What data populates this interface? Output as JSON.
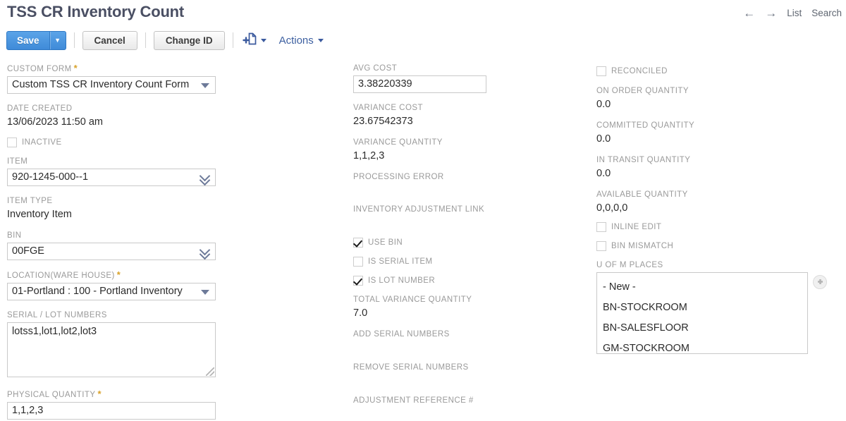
{
  "header": {
    "title": "TSS CR Inventory Count",
    "nav": {
      "back_icon": "arrow-left-icon",
      "forward_icon": "arrow-right-icon",
      "list_label": "List",
      "search_label": "Search"
    }
  },
  "toolbar": {
    "save_label": "Save",
    "save_dropdown_caret": "▼",
    "cancel_label": "Cancel",
    "change_id_label": "Change ID",
    "new_doc_icon": "new-document-plus-icon",
    "actions_label": "Actions"
  },
  "colors": {
    "primary_button": "#3f8bd8",
    "title_text": "#4a4f63",
    "label_text": "#9a9a9a",
    "value_text": "#2b2b2b",
    "required_marker": "#d8a22a",
    "link_text": "#3c5fa0"
  },
  "left_column": {
    "custom_form": {
      "label": "CUSTOM FORM",
      "required": "*",
      "value": "Custom TSS CR Inventory Count Form"
    },
    "date_created": {
      "label": "DATE CREATED",
      "value": "13/06/2023 11:50 am"
    },
    "inactive": {
      "label": "INACTIVE",
      "checked": false
    },
    "item": {
      "label": "ITEM",
      "value": "920-1245-000--1"
    },
    "item_type": {
      "label": "ITEM TYPE",
      "value": "Inventory Item"
    },
    "bin": {
      "label": "BIN",
      "value": "00FGE"
    },
    "location": {
      "label": "LOCATION(WARE HOUSE)",
      "required": "*",
      "value": "01-Portland : 100 - Portland Inventory"
    },
    "serial_lot_numbers": {
      "label": "SERIAL / LOT NUMBERS",
      "value": "lotss1,lot1,lot2,lot3"
    },
    "physical_quantity": {
      "label": "PHYSICAL QUANTITY",
      "required": "*",
      "value": "1,1,2,3"
    }
  },
  "middle_column": {
    "avg_cost": {
      "label": "AVG COST",
      "value": "3.38220339"
    },
    "variance_cost": {
      "label": "VARIANCE COST",
      "value": "23.67542373"
    },
    "variance_quantity": {
      "label": "VARIANCE QUANTITY",
      "value": "1,1,2,3"
    },
    "processing_error": {
      "label": "PROCESSING ERROR",
      "value": ""
    },
    "inventory_adjustment_link": {
      "label": "INVENTORY ADJUSTMENT LINK",
      "value": ""
    },
    "use_bin": {
      "label": "USE BIN",
      "checked": true
    },
    "is_serial_item": {
      "label": "IS SERIAL ITEM",
      "checked": false
    },
    "is_lot_number": {
      "label": "IS LOT NUMBER",
      "checked": true
    },
    "total_variance_quantity": {
      "label": "TOTAL VARIANCE QUANTITY",
      "value": "7.0"
    },
    "add_serial_numbers": {
      "label": "ADD SERIAL NUMBERS",
      "value": ""
    },
    "remove_serial_numbers": {
      "label": "REMOVE SERIAL NUMBERS",
      "value": ""
    },
    "adjustment_reference": {
      "label": "ADJUSTMENT REFERENCE #",
      "value": ""
    }
  },
  "right_column": {
    "reconciled": {
      "label": "RECONCILED",
      "checked": false
    },
    "on_order_quantity": {
      "label": "ON ORDER QUANTITY",
      "value": "0.0"
    },
    "committed_quantity": {
      "label": "COMMITTED QUANTITY",
      "value": "0.0"
    },
    "in_transit_quantity": {
      "label": "IN TRANSIT QUANTITY",
      "value": "0.0"
    },
    "available_quantity": {
      "label": "AVAILABLE QUANTITY",
      "value": "0,0,0,0"
    },
    "inline_edit": {
      "label": "INLINE EDIT",
      "checked": false
    },
    "bin_mismatch": {
      "label": "BIN MISMATCH",
      "checked": false
    },
    "uom_places": {
      "label": "U OF M PLACES",
      "add_icon": "plus-circle-icon",
      "options": [
        "- New -",
        "BN-STOCKROOM",
        "BN-SALESFLOOR",
        "GM-STOCKROOM"
      ]
    }
  }
}
